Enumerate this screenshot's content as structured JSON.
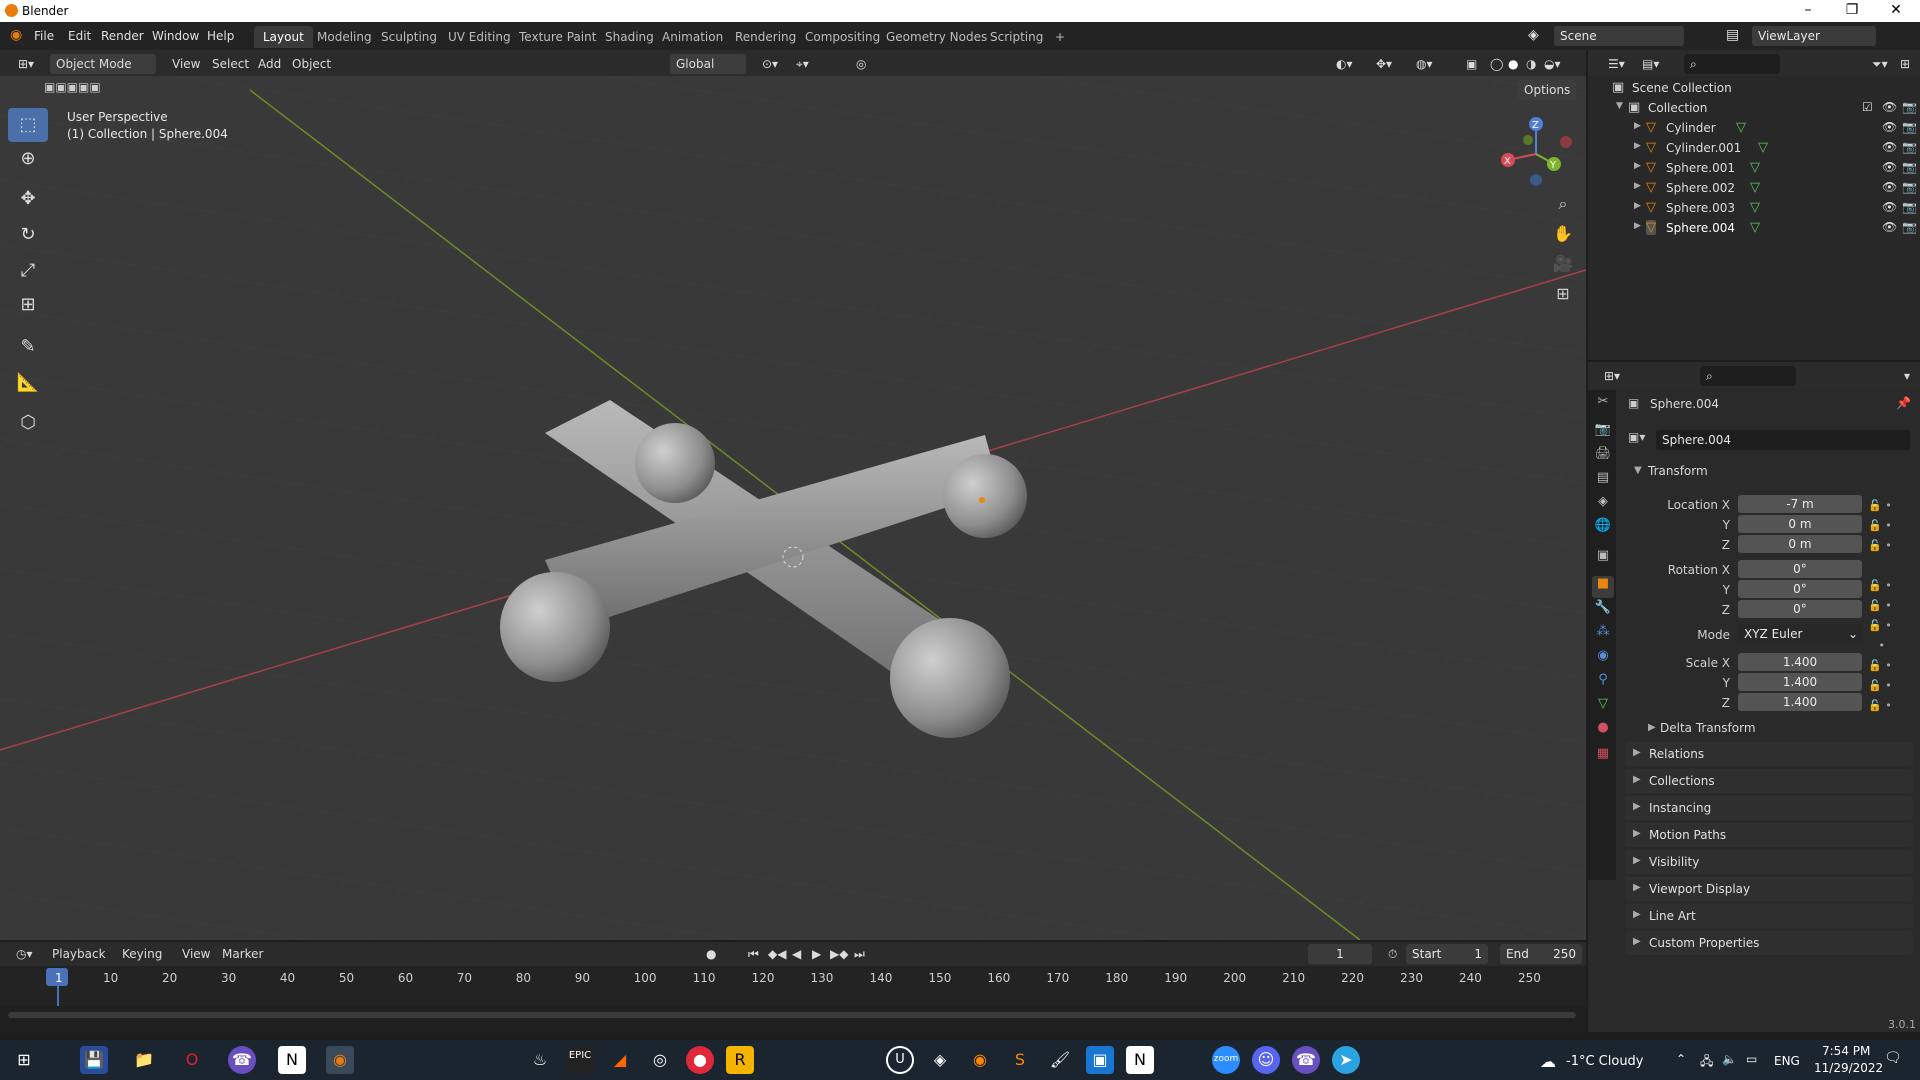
{
  "window": {
    "title": "Blender",
    "controls": [
      "–",
      "❐",
      "✕"
    ]
  },
  "menu": [
    "File",
    "Edit",
    "Render",
    "Window",
    "Help"
  ],
  "workspaces": [
    "Layout",
    "Modeling",
    "Sculpting",
    "UV Editing",
    "Texture Paint",
    "Shading",
    "Animation",
    "Rendering",
    "Compositing",
    "Geometry Nodes",
    "Scripting",
    "+"
  ],
  "scene": {
    "name": "Scene",
    "view_layer": "ViewLayer"
  },
  "viewport_header": {
    "mode": "Object Mode",
    "menus": [
      "View",
      "Select",
      "Add",
      "Object"
    ],
    "orientation": "Global",
    "options": "Options"
  },
  "viewport": {
    "perspective": "User Perspective",
    "collection_info": "(1) Collection | Sphere.004"
  },
  "gizmo": {
    "x": "X",
    "y": "Y",
    "z": "Z"
  },
  "outliner": {
    "root": "Scene Collection",
    "collection": "Collection",
    "items": [
      "Cylinder",
      "Cylinder.001",
      "Sphere.001",
      "Sphere.002",
      "Sphere.003",
      "Sphere.004"
    ]
  },
  "properties": {
    "object_name": "Sphere.004",
    "data_name": "Sphere.004",
    "transform_label": "Transform",
    "location": {
      "label_x": "Location X",
      "x": "-7 m",
      "y": "0 m",
      "z": "0 m"
    },
    "rotation": {
      "label_x": "Rotation X",
      "x": "0°",
      "y": "0°",
      "z": "0°"
    },
    "mode": {
      "label": "Mode",
      "value": "XYZ Euler"
    },
    "scale": {
      "label_x": "Scale X",
      "x": "1.400",
      "y": "1.400",
      "z": "1.400"
    },
    "axis_y": "Y",
    "axis_z": "Z",
    "delta": "Delta Transform",
    "panels": [
      "Relations",
      "Collections",
      "Instancing",
      "Motion Paths",
      "Visibility",
      "Viewport Display",
      "Line Art",
      "Custom Properties"
    ]
  },
  "timeline": {
    "menus": [
      "Playback",
      "Keying",
      "View",
      "Marker"
    ],
    "current_frame": "1",
    "start_label": "Start",
    "start": "1",
    "end_label": "End",
    "end": "250",
    "ticks": [
      "1",
      "10",
      "20",
      "30",
      "40",
      "50",
      "60",
      "70",
      "80",
      "90",
      "100",
      "110",
      "120",
      "130",
      "140",
      "150",
      "160",
      "170",
      "180",
      "190",
      "200",
      "210",
      "220",
      "230",
      "240",
      "250"
    ]
  },
  "version": "3.0.1",
  "taskbar": {
    "weather": "-1°C  Cloudy",
    "lang": "ENG",
    "time": "7:54 PM",
    "date": "11/29/2022",
    "zoom_label": "zoom"
  },
  "colors": {
    "accent": "#4b6fa8",
    "selected_row": "#334d80",
    "object_orange": "#e8860d",
    "x_axis": "#c0404a",
    "y_axis": "#7a9c2a"
  }
}
